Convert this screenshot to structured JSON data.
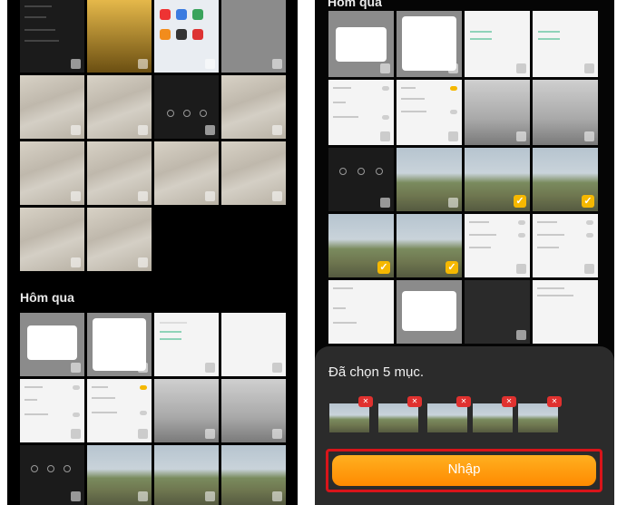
{
  "left_panel": {
    "section_label": "Hôm qua"
  },
  "right_panel": {
    "section_label": "Hôm qua",
    "selection": {
      "count_text": "Đã chọn 5 mục.",
      "remove_label": "✕",
      "import_label": "Nhập"
    }
  },
  "colors": {
    "accent": "#ff9a0e",
    "checkmark": "#f5b800",
    "remove_badge": "#e0312f",
    "highlight_border": "#d8141a"
  },
  "icons": {
    "check": "checkmark-icon",
    "remove": "close-icon"
  }
}
